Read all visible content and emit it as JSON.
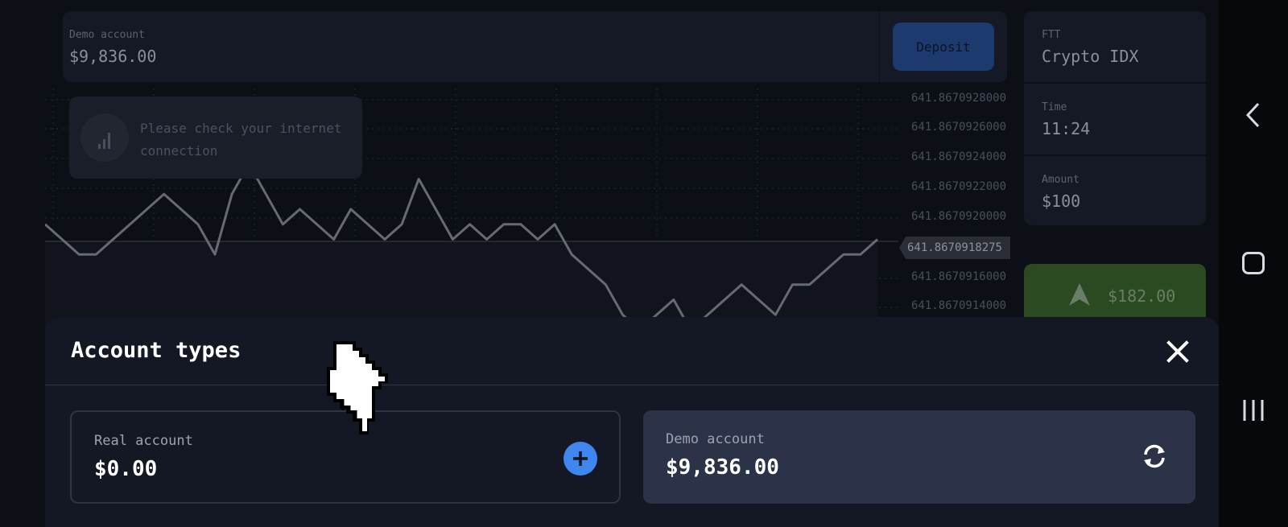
{
  "header": {
    "account_label": "Demo account",
    "account_balance": "$9,836.00",
    "deposit_label": "Deposit"
  },
  "side_panel": {
    "asset": {
      "label": "FTT",
      "value": "Crypto IDX"
    },
    "time": {
      "label": "Time",
      "value": "11:24"
    },
    "amount": {
      "label": "Amount",
      "value": "$100"
    },
    "up_payout": "$182.00"
  },
  "chart_data": {
    "type": "line",
    "y_tick_labels": [
      "641.8670928000",
      "641.8670926000",
      "641.8670924000",
      "641.8670922000",
      "641.8670920000",
      "641.8670916000",
      "641.8670914000"
    ],
    "current_price": "641.8670918275",
    "ylim": [
      641.8670913,
      641.8670929
    ],
    "grid": true,
    "values": [
      641.867092,
      641.8670919,
      641.8670918,
      641.8670918,
      641.8670919,
      641.867092,
      641.8670921,
      641.8670922,
      641.8670921,
      641.867092,
      641.8670918,
      641.8670922,
      641.8670924,
      641.8670922,
      641.867092,
      641.8670921,
      641.867092,
      641.8670919,
      641.8670921,
      641.867092,
      641.8670919,
      641.867092,
      641.8670923,
      641.8670921,
      641.8670919,
      641.867092,
      641.8670919,
      641.867092,
      641.867092,
      641.8670919,
      641.867092,
      641.8670918,
      641.8670917,
      641.8670916,
      641.8670914,
      641.8670913,
      641.8670914,
      641.8670915,
      641.8670913,
      641.8670914,
      641.8670915,
      641.8670916,
      641.8670915,
      641.8670914,
      641.8670916,
      641.8670916,
      641.8670917,
      641.8670918,
      641.8670918,
      641.8670919
    ]
  },
  "toast": {
    "message": "Please check your internet connection"
  },
  "account_sheet": {
    "title": "Account types",
    "real": {
      "label": "Real account",
      "balance": "$0.00"
    },
    "demo": {
      "label": "Demo account",
      "balance": "$9,836.00"
    }
  },
  "icons": {
    "signal": "signal-bars-icon",
    "close": "close-icon",
    "add": "plus-icon",
    "refresh": "refresh-icon",
    "up": "arrow-up-icon",
    "back": "back-icon",
    "home": "home-icon",
    "recents": "recents-icon",
    "cursor": "hand-pointer-icon"
  },
  "colors": {
    "deposit": "#1d3a6e",
    "up": "#2a4a21",
    "add": "#3f86ef",
    "demo_card": "#2c3248"
  }
}
